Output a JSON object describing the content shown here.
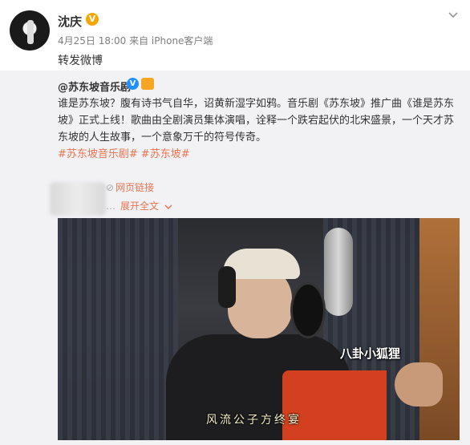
{
  "user": {
    "name": "沈庆",
    "meta": "4月25日 18:00 来自 iPhone客户端",
    "repost_text": "转发微博"
  },
  "original": {
    "author": "@苏东坡音乐剧",
    "text": "谁是苏东坡？腹有诗书气自华，诏黄新湿字如鸦。音乐剧《苏东坡》推广曲《谁是苏东坡》正式上线！歌曲由全剧演员集体演唱，诠释一个跌宕起伏的北宋盛景，一个天才苏东坡的人生故事，一个意象万千的符号传奇。",
    "topics": [
      "#苏东坡音乐剧#",
      "#苏东坡#"
    ],
    "link_label": "网页链接",
    "expand_label": "展开全文"
  },
  "video": {
    "subtitle": "风流公子方终宴",
    "watermark": "八卦小狐狸"
  },
  "icons": {
    "verified": "verified-badge-icon",
    "chevron": "chevron-down-icon",
    "link": "link-icon",
    "expand": "expand-chevron-icon"
  },
  "colors": {
    "accent": "#eb7350",
    "verified_gold": "#f7a500",
    "verified_blue": "#1e90ff",
    "quote_bg": "#f2f2f5"
  }
}
